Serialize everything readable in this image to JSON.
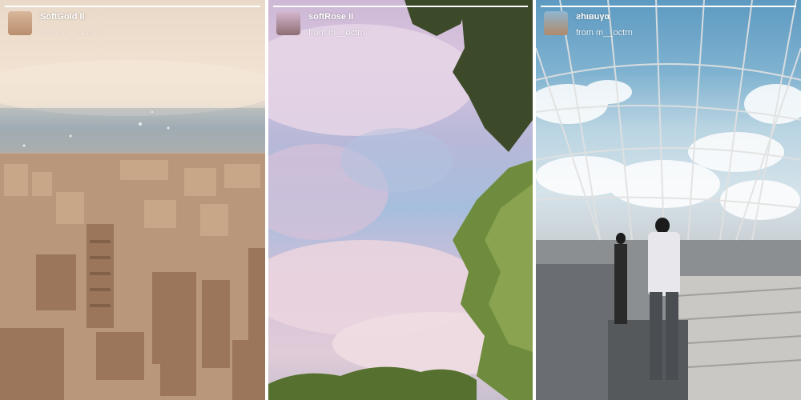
{
  "stories": [
    {
      "filter_name": "SoftGold II",
      "source": "from m__octrn",
      "progress": 1.0,
      "scene": "city-skyline-aerial"
    },
    {
      "filter_name": "softRose II",
      "source": "from m__octrn",
      "progress": 1.0,
      "scene": "pink-clouds-trees"
    },
    {
      "filter_name": "ƨhιвuγα",
      "source": "from m__octrn",
      "progress": 1.0,
      "scene": "rooftop-observation-deck"
    }
  ],
  "colors": {
    "soft_gold_tint": "#c9a37f",
    "soft_rose_tint": "#d6bcd8",
    "sky_blue": "#6fa6c8"
  }
}
